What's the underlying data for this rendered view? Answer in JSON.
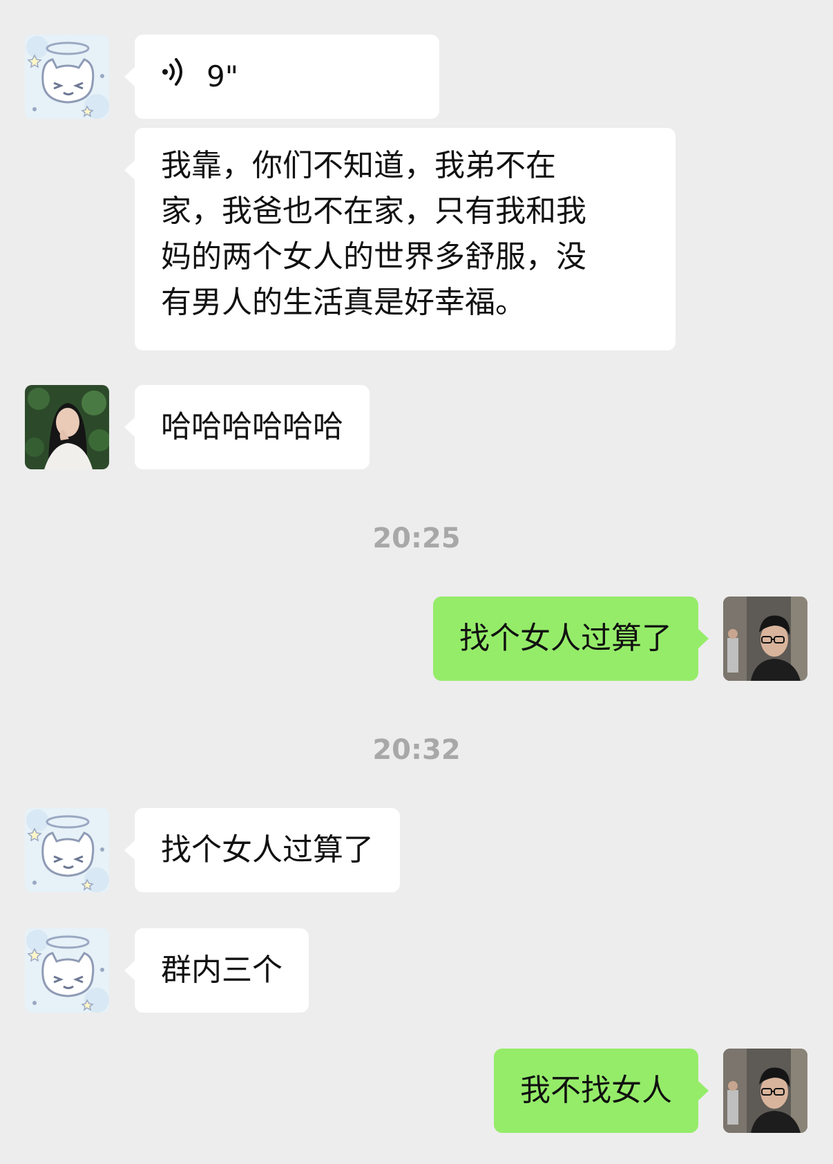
{
  "colors": {
    "background": "#ededed",
    "incoming_bubble": "#ffffff",
    "outgoing_bubble": "#95ec69",
    "timestamp": "#a8a8a8"
  },
  "messages": [
    {
      "side": "left",
      "avatar": "cat-angel-avatar",
      "type": "voice",
      "icon": "voice-wave-icon",
      "duration": "9\""
    },
    {
      "side": "left",
      "avatar": "cat-angel-avatar",
      "type": "text",
      "lines": [
        "我靠，你们不知道，我弟不在",
        "家，我爸也不在家，只有我和我",
        "妈的两个女人的世界多舒服，没",
        "有男人的生活真是好幸福。"
      ]
    },
    {
      "side": "left",
      "avatar": "woman-photo-avatar",
      "type": "text",
      "text": "哈哈哈哈哈哈"
    },
    {
      "type": "timestamp",
      "text": "20:25"
    },
    {
      "side": "right",
      "avatar": "man-glasses-avatar",
      "type": "text",
      "text": "找个女人过算了"
    },
    {
      "type": "timestamp",
      "text": "20:32"
    },
    {
      "side": "left",
      "avatar": "cat-angel-avatar",
      "type": "text",
      "text": "找个女人过算了"
    },
    {
      "side": "left",
      "avatar": "cat-angel-avatar",
      "type": "text",
      "text": "群内三个"
    },
    {
      "side": "right",
      "avatar": "man-glasses-avatar",
      "type": "text",
      "text": "我不找女人"
    }
  ]
}
